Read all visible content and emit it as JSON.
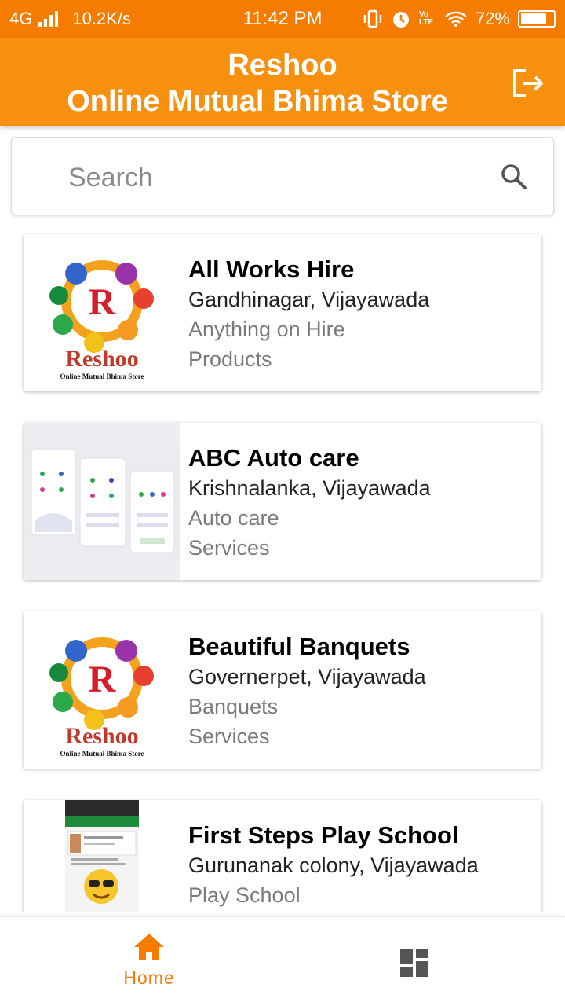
{
  "status": {
    "network": "4G",
    "speed": "10.2K/s",
    "time": "11:42 PM",
    "volte": "Vo LTE",
    "battery": "72%",
    "battery_level": 0.72
  },
  "header": {
    "title_line1": "Reshoo",
    "title_line2": "Online Mutual Bhima Store",
    "logout_icon": "logout-icon",
    "color": "#f7900f"
  },
  "search": {
    "placeholder": "Search",
    "value": ""
  },
  "listings": [
    {
      "name": "All Works Hire",
      "location": "Gandhinagar, Vijayawada",
      "category": "Anything on Hire",
      "type": "Products",
      "thumb": "reshoo-logo",
      "logo_text": "Reshoo",
      "logo_sub": "Online Mutual Bhima Store"
    },
    {
      "name": "ABC Auto care",
      "location": "Krishnalanka, Vijayawada",
      "category": "Auto care",
      "type": "Services",
      "thumb": "app-screens-image"
    },
    {
      "name": "Beautiful Banquets",
      "location": "Governerpet, Vijayawada",
      "category": "Banquets",
      "type": "Services",
      "thumb": "reshoo-logo",
      "logo_text": "Reshoo",
      "logo_sub": "Online Mutual Bhima Store"
    },
    {
      "name": "First Steps Play School",
      "location": "Gurunanak colony, Vijayawada",
      "category": "Play School",
      "type": "",
      "thumb": "chat-screenshot-image"
    }
  ],
  "bottom_nav": {
    "home_label": "Home",
    "home_icon": "home-icon",
    "dashboard_icon": "dashboard-icon",
    "active_color": "#f57c00"
  }
}
